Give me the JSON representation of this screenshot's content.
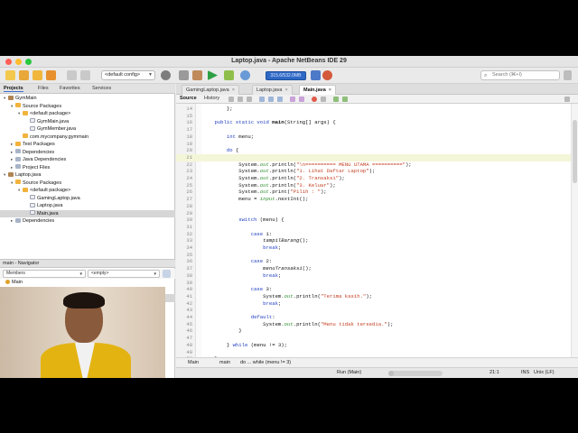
{
  "window": {
    "title": "Laptop.java - Apache NetBeans IDE 29"
  },
  "toolbar": {
    "config": "<default config>",
    "memory": "315.6/532.0MB",
    "search_placeholder": "Search (⌘+I)"
  },
  "projects_tabs": [
    "Projects",
    "Files",
    "Favorites",
    "Services"
  ],
  "project_tree": [
    {
      "label": "GymMain",
      "icon": "project",
      "indent": 0,
      "expanded": true
    },
    {
      "label": "Source Packages",
      "icon": "package",
      "indent": 1,
      "expanded": true
    },
    {
      "label": "<default package>",
      "icon": "package",
      "indent": 2,
      "expanded": true
    },
    {
      "label": "GymMain.java",
      "icon": "java",
      "indent": 3
    },
    {
      "label": "GymMember.java",
      "icon": "java",
      "indent": 3
    },
    {
      "label": "com.mycompany.gymmain",
      "icon": "package",
      "indent": 2
    },
    {
      "label": "Test Packages",
      "icon": "package",
      "indent": 1,
      "expanded": false
    },
    {
      "label": "Dependencies",
      "icon": "library",
      "indent": 1,
      "expanded": false
    },
    {
      "label": "Java Dependencies",
      "icon": "library",
      "indent": 1,
      "expanded": false
    },
    {
      "label": "Project Files",
      "icon": "library",
      "indent": 1,
      "expanded": false
    },
    {
      "label": "Laptop.java",
      "icon": "project",
      "indent": 0,
      "expanded": true
    },
    {
      "label": "Source Packages",
      "icon": "package",
      "indent": 1,
      "expanded": true
    },
    {
      "label": "<default package>",
      "icon": "package",
      "indent": 2,
      "expanded": true
    },
    {
      "label": "GamingLaptop.java",
      "icon": "java",
      "indent": 3
    },
    {
      "label": "Laptop.java",
      "icon": "java",
      "indent": 3
    },
    {
      "label": "Main.java",
      "icon": "java",
      "indent": 3,
      "selected": true
    },
    {
      "label": "Dependencies",
      "icon": "library",
      "indent": 1,
      "expanded": false
    }
  ],
  "navigator": {
    "title": "main - Navigator",
    "filter": "Members",
    "scope": "<empty>",
    "items": [
      {
        "label": "Main",
        "indent": 0,
        "color": "#e0a32a"
      },
      {
        "label": "Main()",
        "indent": 1,
        "color": "#e0a32a"
      },
      {
        "label": "main(String[] args)",
        "indent": 1,
        "color": "#d94b4b",
        "selected": true
      },
      {
        "label": "menuTransaksi()",
        "indent": 1,
        "color": "#d94b4b"
      },
      {
        "label": "tampilBarang()",
        "indent": 1,
        "color": "#d94b4b"
      }
    ]
  },
  "editor": {
    "tabs": [
      {
        "label": "GamingLaptop.java",
        "active": false
      },
      {
        "label": "Laptop.java",
        "active": false
      },
      {
        "label": "Main.java",
        "active": true
      }
    ],
    "subtabs": [
      "Source",
      "History"
    ],
    "current_line": 21,
    "lines": [
      {
        "n": 14,
        "segs": [
          [
            "",
            "        };"
          ]
        ]
      },
      {
        "n": 15,
        "segs": [
          [
            "",
            ""
          ]
        ]
      },
      {
        "n": 16,
        "segs": [
          [
            "",
            "    "
          ],
          [
            "kw",
            "public static void "
          ],
          [
            "fn",
            "main"
          ],
          [
            "",
            "(String[] args) {"
          ]
        ]
      },
      {
        "n": 17,
        "segs": [
          [
            "",
            ""
          ]
        ]
      },
      {
        "n": 18,
        "segs": [
          [
            "",
            "        "
          ],
          [
            "kw",
            "int"
          ],
          [
            "",
            " menu;"
          ]
        ]
      },
      {
        "n": 19,
        "segs": [
          [
            "",
            ""
          ]
        ]
      },
      {
        "n": 20,
        "segs": [
          [
            "",
            "        "
          ],
          [
            "kw",
            "do"
          ],
          [
            "",
            " {"
          ]
        ]
      },
      {
        "n": 21,
        "segs": [
          [
            "",
            ""
          ]
        ]
      },
      {
        "n": 22,
        "segs": [
          [
            "",
            "            System."
          ],
          [
            "fld",
            "out"
          ],
          [
            "",
            ".println("
          ],
          [
            "str",
            "\"\\n========== MENU UTAMA ==========\""
          ],
          [
            "",
            ");"
          ]
        ]
      },
      {
        "n": 23,
        "segs": [
          [
            "",
            "            System."
          ],
          [
            "fld",
            "out"
          ],
          [
            "",
            ".println("
          ],
          [
            "str",
            "\"1. Lihat Daftar Laptop\""
          ],
          [
            "",
            ");"
          ]
        ]
      },
      {
        "n": 24,
        "segs": [
          [
            "",
            "            System."
          ],
          [
            "fld",
            "out"
          ],
          [
            "",
            ".println("
          ],
          [
            "str",
            "\"2. Transaksi\""
          ],
          [
            "",
            ");"
          ]
        ]
      },
      {
        "n": 25,
        "segs": [
          [
            "",
            "            System."
          ],
          [
            "fld",
            "out"
          ],
          [
            "",
            ".println("
          ],
          [
            "str",
            "\"3. Keluar\""
          ],
          [
            "",
            ");"
          ]
        ]
      },
      {
        "n": 26,
        "segs": [
          [
            "",
            "            System."
          ],
          [
            "fld",
            "out"
          ],
          [
            "",
            ".print("
          ],
          [
            "str",
            "\"Pilih : \""
          ],
          [
            "",
            ");"
          ]
        ]
      },
      {
        "n": 27,
        "segs": [
          [
            "",
            "            menu = "
          ],
          [
            "fld",
            "input"
          ],
          [
            "",
            ".nextInt();"
          ]
        ]
      },
      {
        "n": 28,
        "segs": [
          [
            "",
            ""
          ]
        ]
      },
      {
        "n": 29,
        "segs": [
          [
            "",
            ""
          ]
        ]
      },
      {
        "n": 30,
        "segs": [
          [
            "",
            "            "
          ],
          [
            "kw",
            "switch"
          ],
          [
            "",
            " (menu) {"
          ]
        ]
      },
      {
        "n": 31,
        "segs": [
          [
            "",
            ""
          ]
        ]
      },
      {
        "n": 32,
        "segs": [
          [
            "",
            "                "
          ],
          [
            "kw",
            "case"
          ],
          [
            "",
            " 1:"
          ]
        ]
      },
      {
        "n": 33,
        "segs": [
          [
            "",
            "                    "
          ],
          [
            "mth",
            "tampilBarang"
          ],
          [
            "",
            "();"
          ]
        ]
      },
      {
        "n": 34,
        "segs": [
          [
            "",
            "                    "
          ],
          [
            "kw",
            "break"
          ],
          [
            "",
            ";"
          ]
        ]
      },
      {
        "n": 35,
        "segs": [
          [
            "",
            ""
          ]
        ]
      },
      {
        "n": 36,
        "segs": [
          [
            "",
            "                "
          ],
          [
            "kw",
            "case"
          ],
          [
            "",
            " 2:"
          ]
        ]
      },
      {
        "n": 37,
        "segs": [
          [
            "",
            "                    "
          ],
          [
            "mth",
            "menuTransaksi"
          ],
          [
            "",
            "();"
          ]
        ]
      },
      {
        "n": 38,
        "segs": [
          [
            "",
            "                    "
          ],
          [
            "kw",
            "break"
          ],
          [
            "",
            ";"
          ]
        ]
      },
      {
        "n": 39,
        "segs": [
          [
            "",
            ""
          ]
        ]
      },
      {
        "n": 40,
        "segs": [
          [
            "",
            "                "
          ],
          [
            "kw",
            "case"
          ],
          [
            "",
            " 3:"
          ]
        ]
      },
      {
        "n": 41,
        "segs": [
          [
            "",
            "                    System."
          ],
          [
            "fld",
            "out"
          ],
          [
            "",
            ".println("
          ],
          [
            "str",
            "\"Terima kasih.\""
          ],
          [
            "",
            ");"
          ]
        ]
      },
      {
        "n": 42,
        "segs": [
          [
            "",
            "                    "
          ],
          [
            "kw",
            "break"
          ],
          [
            "",
            ";"
          ]
        ]
      },
      {
        "n": 43,
        "segs": [
          [
            "",
            ""
          ]
        ]
      },
      {
        "n": 44,
        "segs": [
          [
            "",
            "                "
          ],
          [
            "kw",
            "default"
          ],
          [
            "",
            ":"
          ]
        ]
      },
      {
        "n": 45,
        "segs": [
          [
            "",
            "                    System."
          ],
          [
            "fld",
            "out"
          ],
          [
            "",
            ".println("
          ],
          [
            "str",
            "\"Menu tidak tersedia.\""
          ],
          [
            "",
            ");"
          ]
        ]
      },
      {
        "n": 46,
        "segs": [
          [
            "",
            "            }"
          ]
        ]
      },
      {
        "n": 47,
        "segs": [
          [
            "",
            ""
          ]
        ]
      },
      {
        "n": 48,
        "segs": [
          [
            "",
            "        } "
          ],
          [
            "kw",
            "while"
          ],
          [
            "",
            " (menu != 3);"
          ]
        ]
      },
      {
        "n": 49,
        "segs": [
          [
            "",
            ""
          ]
        ]
      },
      {
        "n": 50,
        "segs": [
          [
            "",
            "    }"
          ]
        ]
      }
    ]
  },
  "breadcrumb": [
    "Main",
    "main",
    "do ... while (menu != 3)"
  ],
  "status": {
    "run_label": "Run (Main)",
    "position": "21:1",
    "mode": "INS",
    "line_ending": "Unix (LF)",
    "progress": 0.1
  },
  "colors": {
    "accent": "#2f69c5",
    "keyword": "#1f3fbf",
    "string": "#c33c1f",
    "jacket": "#e3b312"
  }
}
